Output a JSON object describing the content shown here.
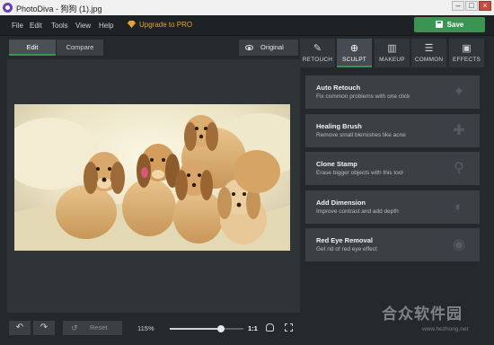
{
  "window": {
    "title": "PhotoDiva - 狗狗 (1).jpg",
    "minimize": "–",
    "maximize": "□",
    "close": "×"
  },
  "menu": {
    "items": [
      "File",
      "Edit",
      "Tools",
      "View",
      "Help"
    ],
    "upgrade_label": "Upgrade to PRO",
    "save_label": "Save"
  },
  "workspace": {
    "tabs": [
      "Edit",
      "Compare"
    ],
    "original_label": "Original",
    "undo_glyph": "↶",
    "redo_glyph": "↷",
    "reset_label": "Reset",
    "reset_glyph": "↺",
    "zoom": "115%",
    "zoom_fraction": 0.7,
    "fit_label": "1:1"
  },
  "tool_tabs": [
    {
      "label": "RETOUCH",
      "icon": "brush-icon",
      "glyph": "✎"
    },
    {
      "label": "SCULPT",
      "icon": "sculpt-icon",
      "glyph": "⊕"
    },
    {
      "label": "MAKEUP",
      "icon": "makeup-icon",
      "glyph": "▥"
    },
    {
      "label": "COMMON",
      "icon": "sliders-icon",
      "glyph": "☰"
    },
    {
      "label": "EFFECTS",
      "icon": "effects-icon",
      "glyph": "▣"
    }
  ],
  "tools": [
    {
      "title": "Auto Retouch",
      "desc": "Fix common problems with one click",
      "glyph": "✦"
    },
    {
      "title": "Healing Brush",
      "desc": "Remove small blemishes like acne",
      "glyph": "✚"
    },
    {
      "title": "Clone Stamp",
      "desc": "Erase bigger objects with this tool",
      "glyph": "⚲"
    },
    {
      "title": "Add Dimension",
      "desc": "Improve contrast and add depth",
      "glyph": "◐"
    },
    {
      "title": "Red Eye Removal",
      "desc": "Get rid of red eye effect",
      "glyph": "◉"
    }
  ],
  "watermark": {
    "text": "合众软件园",
    "url": "www.hezhong.net"
  },
  "colors": {
    "accent": "#3a9552",
    "upgrade": "#e3a437",
    "panel": "#3a4043"
  }
}
